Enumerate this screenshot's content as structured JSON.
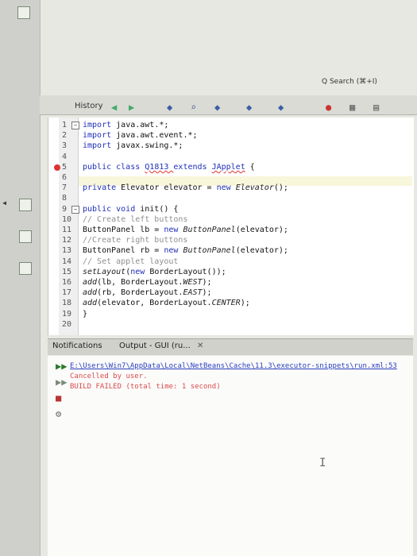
{
  "window": {
    "tab": "History",
    "corner_search": "Q Search (⌘+I)"
  },
  "toolbar": {
    "icons": [
      "back-icon",
      "forward-icon",
      "run-icon",
      "search-icon",
      "bookmark-icon",
      "comment-icon",
      "stop-icon",
      "chart-icon",
      "build-icon"
    ]
  },
  "editor": {
    "lines": [
      {
        "n": "1",
        "parts": [
          {
            "t": "import ",
            "c": "kw"
          },
          {
            "t": "java.awt.*;",
            "c": ""
          }
        ]
      },
      {
        "n": "2",
        "parts": [
          {
            "t": "import ",
            "c": "kw"
          },
          {
            "t": "java.awt.event.*;",
            "c": ""
          }
        ]
      },
      {
        "n": "3",
        "parts": [
          {
            "t": "import ",
            "c": "kw"
          },
          {
            "t": "javax.swing.*;",
            "c": ""
          }
        ]
      },
      {
        "n": "4",
        "parts": []
      },
      {
        "n": "5",
        "parts": [
          {
            "t": "public class ",
            "c": "kw"
          },
          {
            "t": "Q1813 ",
            "c": "err"
          },
          {
            "t": "extends ",
            "c": "kw"
          },
          {
            "t": "JApplet",
            "c": "err"
          },
          {
            "t": " {",
            "c": ""
          }
        ]
      },
      {
        "n": "6",
        "parts": []
      },
      {
        "n": "7",
        "parts": [
          {
            "t": "private ",
            "c": "kw"
          },
          {
            "t": "Elevator elevator = ",
            "c": ""
          },
          {
            "t": "new ",
            "c": "kw"
          },
          {
            "t": "Elevator",
            "c": "it"
          },
          {
            "t": "();",
            "c": ""
          }
        ]
      },
      {
        "n": "8",
        "parts": []
      },
      {
        "n": "9",
        "parts": [
          {
            "t": "public void ",
            "c": "kw"
          },
          {
            "t": "init() {",
            "c": ""
          }
        ]
      },
      {
        "n": "10",
        "parts": [
          {
            "t": "// Create left buttons",
            "c": "com"
          }
        ]
      },
      {
        "n": "11",
        "parts": [
          {
            "t": "ButtonPanel lb = ",
            "c": ""
          },
          {
            "t": "new ",
            "c": "kw"
          },
          {
            "t": "ButtonPanel",
            "c": "it"
          },
          {
            "t": "(elevator);",
            "c": ""
          }
        ]
      },
      {
        "n": "12",
        "parts": [
          {
            "t": "//Create right buttons",
            "c": "com"
          }
        ]
      },
      {
        "n": "13",
        "parts": [
          {
            "t": "ButtonPanel rb = ",
            "c": ""
          },
          {
            "t": "new ",
            "c": "kw"
          },
          {
            "t": "ButtonPanel",
            "c": "it"
          },
          {
            "t": "(elevator);",
            "c": ""
          }
        ]
      },
      {
        "n": "14",
        "parts": [
          {
            "t": "// Set applet layout",
            "c": "com"
          }
        ]
      },
      {
        "n": "15",
        "parts": [
          {
            "t": "setLayout",
            "c": "it"
          },
          {
            "t": "(",
            "c": ""
          },
          {
            "t": "new ",
            "c": "kw"
          },
          {
            "t": "BorderLayout());",
            "c": ""
          }
        ]
      },
      {
        "n": "16",
        "parts": [
          {
            "t": "add",
            "c": "it"
          },
          {
            "t": "(lb, BorderLayout.",
            "c": ""
          },
          {
            "t": "WEST",
            "c": "it"
          },
          {
            "t": ");",
            "c": ""
          }
        ]
      },
      {
        "n": "17",
        "parts": [
          {
            "t": "add",
            "c": "it"
          },
          {
            "t": "(rb, BorderLayout.",
            "c": ""
          },
          {
            "t": "EAST",
            "c": "it"
          },
          {
            "t": ");",
            "c": ""
          }
        ]
      },
      {
        "n": "18",
        "parts": [
          {
            "t": "add",
            "c": "it"
          },
          {
            "t": "(elevator, BorderLayout.",
            "c": ""
          },
          {
            "t": "CENTER",
            "c": "it"
          },
          {
            "t": ");",
            "c": ""
          }
        ]
      },
      {
        "n": "19",
        "parts": [
          {
            "t": "}",
            "c": ""
          }
        ]
      },
      {
        "n": "20",
        "parts": []
      }
    ]
  },
  "bottom_panel": {
    "tabs": [
      "Notifications",
      "Output - GUI (ru..."
    ],
    "output": [
      {
        "text": "E:\\Users\\Win7\\AppData\\Local\\NetBeans\\Cache\\11.3\\executor-snippets\\run.xml:53",
        "style": "out-link"
      },
      {
        "text": "Cancelled by user.",
        "style": "out-red"
      },
      {
        "text": "BUILD FAILED (total time: 1 second)",
        "style": "out-red"
      }
    ]
  }
}
